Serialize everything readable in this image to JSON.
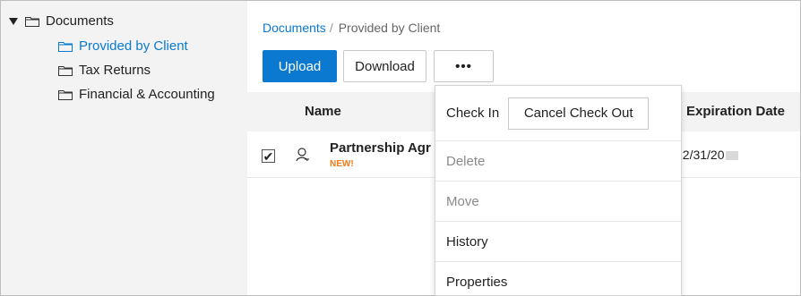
{
  "tree": {
    "root": {
      "label": "Documents",
      "icon": "folder-icon"
    },
    "children": [
      {
        "label": "Provided by Client",
        "active": true,
        "icon": "folder-icon"
      },
      {
        "label": "Tax Returns",
        "active": false,
        "icon": "folder-icon"
      },
      {
        "label": "Financial & Accounting",
        "active": false,
        "icon": "folder-icon"
      }
    ]
  },
  "breadcrumb": {
    "root": "Documents",
    "separator": "/",
    "current": "Provided by Client"
  },
  "toolbar": {
    "upload_label": "Upload",
    "download_label": "Download",
    "more_label": "•••"
  },
  "table": {
    "columns": {
      "name": "Name",
      "expiration": "Expiration Date"
    },
    "rows": [
      {
        "name": "Partnership Agr",
        "badge": "NEW!",
        "expiration": "12/31/20",
        "checked": true,
        "owner_icon": "person-icon"
      }
    ]
  },
  "menu": {
    "check_in": "Check In",
    "cancel_check_out": "Cancel Check Out",
    "items": [
      {
        "label": "Delete",
        "disabled": true
      },
      {
        "label": "Move",
        "disabled": true
      },
      {
        "label": "History",
        "disabled": false
      },
      {
        "label": "Properties",
        "disabled": false
      }
    ]
  },
  "colors": {
    "accent": "#0a79cf",
    "badge": "#f07a18",
    "sidebar_bg": "#f3f3f3"
  }
}
